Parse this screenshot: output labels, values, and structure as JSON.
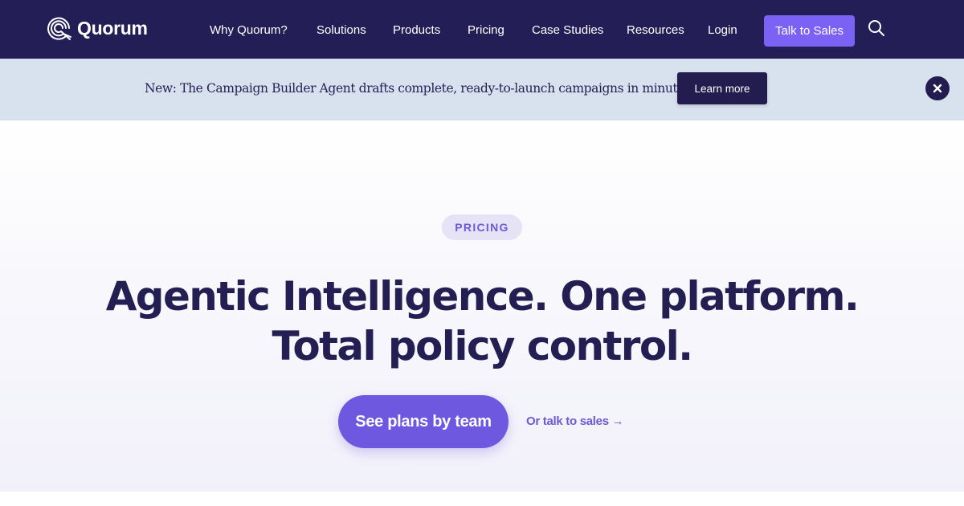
{
  "brand": {
    "name": "Quorum",
    "logo_icon": "quorum-swirl-logo"
  },
  "nav": {
    "links": [
      "Why Quorum?",
      "Solutions",
      "Products",
      "Pricing",
      "Case Studies",
      "Resources",
      "Login"
    ],
    "cta_label": "Talk to Sales",
    "search_icon": "search-icon"
  },
  "announcement": {
    "text": "New: The Campaign Builder Agent drafts complete, ready-to-launch campaigns in minutes.",
    "button_label": "Learn more",
    "close_icon": "close-icon"
  },
  "hero": {
    "eyebrow": "PRICING",
    "headline_line1": "Agentic Intelligence. One platform.",
    "headline_line2": "Total policy control.",
    "primary_cta": "See plans by team",
    "secondary_link": "Or talk to sales →"
  },
  "colors": {
    "nav_bg": "#241e57",
    "accent": "#7b62f5",
    "announcement_bg": "#d8e1ee",
    "headline": "#231f52",
    "primary_button": "#6e58e0"
  }
}
